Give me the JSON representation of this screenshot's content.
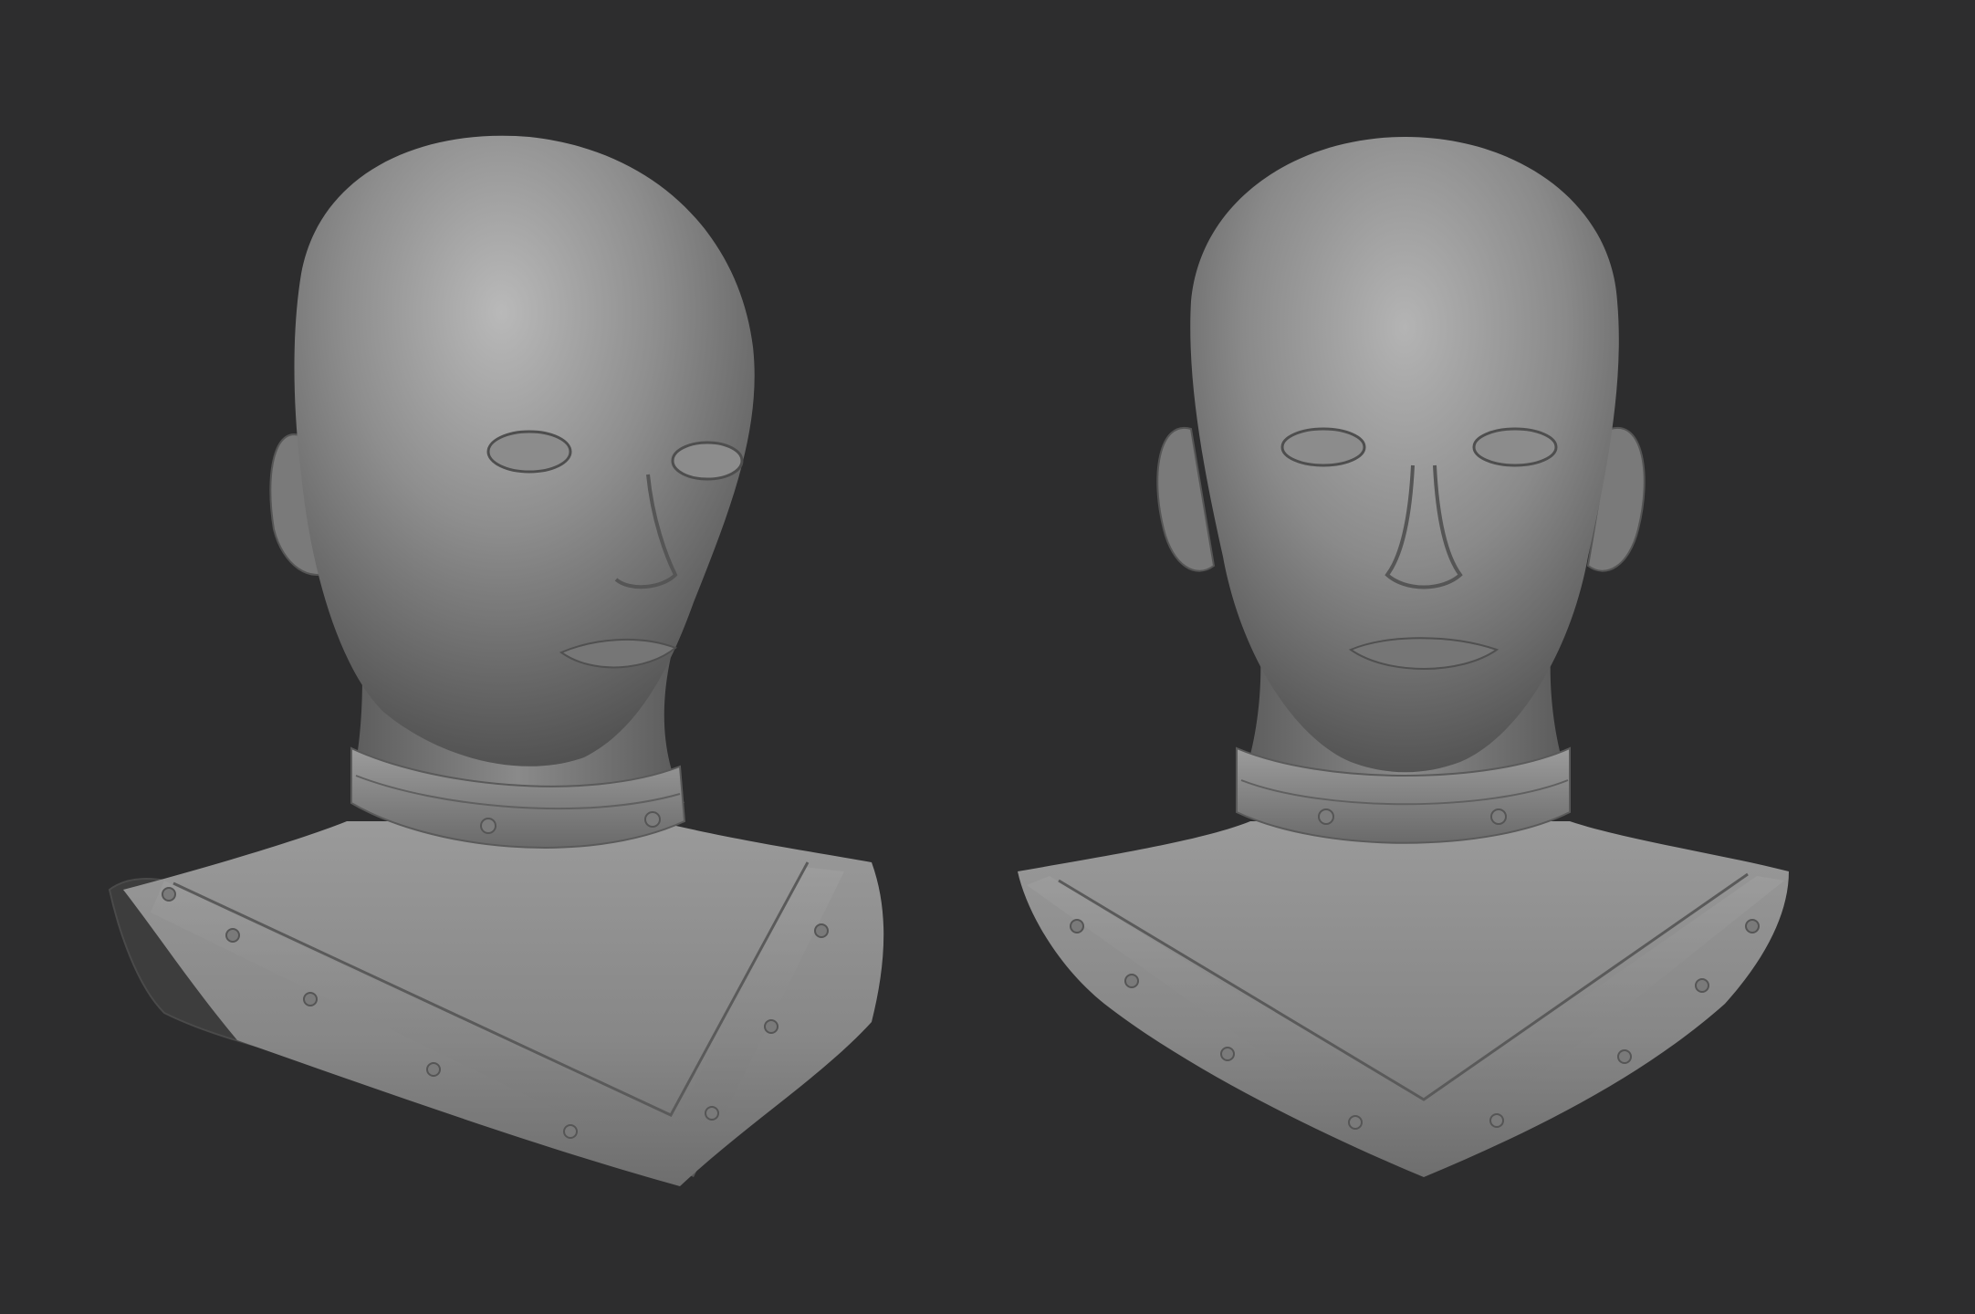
{
  "scene": {
    "background_color": "#2d2d2e",
    "material_color": "#8a8a8a",
    "highlight_color": "#c9c9c9",
    "shadow_color": "#3a3a3a",
    "models": [
      {
        "name": "bust-three-quarter-view",
        "icon": "sculpted-head-icon"
      },
      {
        "name": "bust-front-view",
        "icon": "sculpted-head-icon"
      }
    ]
  }
}
